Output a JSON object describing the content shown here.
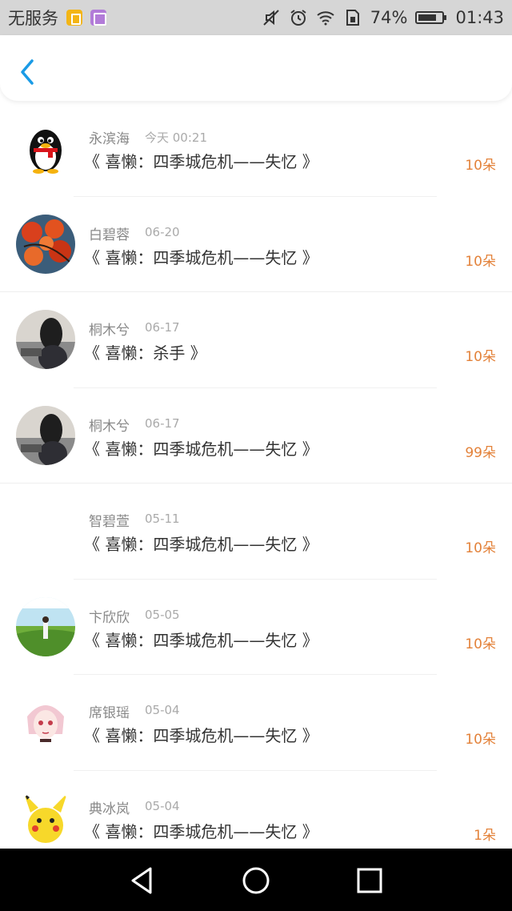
{
  "status_bar": {
    "carrier": "无服务",
    "battery_percent": "74%",
    "time": "01:43"
  },
  "header": {
    "back_icon": "chevron-left-icon",
    "accent_color": "#1a9be6"
  },
  "colors": {
    "count_color": "#e3823a",
    "name_color": "#888888",
    "title_color": "#333333"
  },
  "gifts": [
    {
      "name": "永滨海",
      "time": "今天 00:21",
      "title": "《 喜懒：四季城危机——失忆 》",
      "count": "10朵",
      "avatar": "qq-penguin-avatar"
    },
    {
      "name": "白碧蓉",
      "time": "06-20",
      "title": "《 喜懒：四季城危机——失忆 》",
      "count": "10朵",
      "avatar": "red-leaves-avatar"
    },
    {
      "name": "桐木兮",
      "time": "06-17",
      "title": "《 喜懒：杀手 》",
      "count": "10朵",
      "avatar": "girl-photo-avatar"
    },
    {
      "name": "桐木兮",
      "time": "06-17",
      "title": "《 喜懒：四季城危机——失忆 》",
      "count": "99朵",
      "avatar": "girl-photo-avatar"
    },
    {
      "name": "智碧萱",
      "time": "05-11",
      "title": "《 喜懒：四季城危机——失忆 》",
      "count": "10朵",
      "avatar": "blank-avatar"
    },
    {
      "name": "卞欣欣",
      "time": "05-05",
      "title": "《 喜懒：四季城危机——失忆 》",
      "count": "10朵",
      "avatar": "meadow-girl-avatar"
    },
    {
      "name": "席银瑶",
      "time": "05-04",
      "title": "《 喜懒：四季城危机——失忆 》",
      "count": "10朵",
      "avatar": "anime-girl-avatar"
    },
    {
      "name": "典冰岚",
      "time": "05-04",
      "title": "《 喜懒：四季城危机——失忆 》",
      "count": "1朵",
      "avatar": "pikachu-avatar"
    }
  ]
}
